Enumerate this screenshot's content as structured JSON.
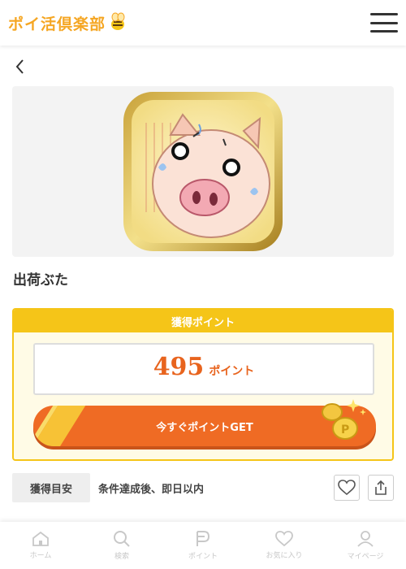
{
  "header": {
    "logo_text": "ポイ活倶楽部",
    "logo_icon": "bee-icon",
    "menu_icon": "hamburger-icon"
  },
  "nav": {
    "back_icon": "chevron-left-icon"
  },
  "app": {
    "title": "出荷ぶた",
    "icon": "pig-app-icon"
  },
  "points": {
    "header": "獲得ポイント",
    "value": "495",
    "unit": "ポイント",
    "cta_label": "今すぐポイントGET"
  },
  "guide": {
    "tag": "獲得目安",
    "text": "条件達成後、即日以内"
  },
  "tabs": [
    {
      "label": "ホーム",
      "icon": "home-icon"
    },
    {
      "label": "検索",
      "icon": "search-icon"
    },
    {
      "label": "ポイント",
      "icon": "point-icon"
    },
    {
      "label": "お気に入り",
      "icon": "heart-icon"
    },
    {
      "label": "マイページ",
      "icon": "person-icon"
    }
  ],
  "colors": {
    "accent": "#ef6b24",
    "brand_yellow": "#f5c518",
    "logo": "#f5a623"
  }
}
